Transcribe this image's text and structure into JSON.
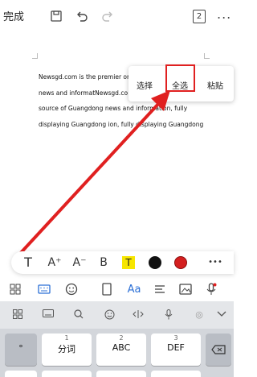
{
  "toolbar": {
    "done_label": "完成",
    "page_count": "2",
    "more_label": "..."
  },
  "document": {
    "lines": [
      "Newsgd.com is the premier or",
      "news   and   informatNewsgd.co",
      "source   of   Guangdong   news   and   information,   fully",
      "displaying Guangdong ion, fully displaying Guangdong"
    ]
  },
  "context_menu": {
    "items": [
      "选择",
      "全选",
      "粘贴"
    ],
    "highlighted": "全选"
  },
  "format_bar": {
    "items": [
      "T",
      "A⁺",
      "A⁻",
      "B",
      "T"
    ],
    "colors": {
      "black": "#111111",
      "red": "#d41f1f",
      "highlight": "#f7e600"
    },
    "more": "•••"
  },
  "keyboard": {
    "keys": [
      {
        "num": "",
        "label": "°"
      },
      {
        "num": "1",
        "label": "分词"
      },
      {
        "num": "2",
        "label": "ABC"
      },
      {
        "num": "3",
        "label": "DEF"
      }
    ]
  },
  "colors": {
    "accent_red": "#e02020",
    "tool_blue": "#2b6fd6"
  }
}
